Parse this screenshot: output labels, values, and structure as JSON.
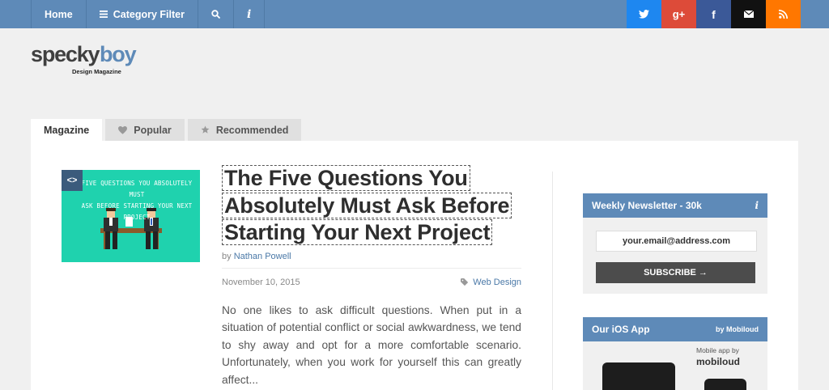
{
  "nav": {
    "home": "Home",
    "category_filter": "Category Filter",
    "search_icon": "search-icon",
    "info_icon": "i"
  },
  "social": [
    {
      "name": "twitter",
      "color": "#1e87f0"
    },
    {
      "name": "google-plus",
      "color": "#dd4b39",
      "label": "g+"
    },
    {
      "name": "facebook",
      "color": "#3b5998",
      "label": "f"
    },
    {
      "name": "email",
      "color": "#111111"
    },
    {
      "name": "rss",
      "color": "#ff7700"
    }
  ],
  "logo": {
    "wordmark": "speckyboy",
    "tagline": "Design Magazine"
  },
  "tabs": {
    "magazine": "Magazine",
    "popular": "Popular",
    "recommended": "Recommended"
  },
  "article": {
    "thumb_badge": "<>",
    "thumb_text_1": "FIVE QUESTIONS YOU ABSOLUTELY MUST",
    "thumb_text_2": "ASK BEFORE STARTING YOUR NEXT PROJECT",
    "title_line1": "The Five Questions You",
    "title_line2": "Absolutely Must Ask Before",
    "title_line3": "Starting Your Next Project",
    "by": "by",
    "author": "Nathan Powell",
    "date": "November 10, 2015",
    "category": "Web Design",
    "excerpt": "No one likes to ask difficult questions. When put in a situation of potential conflict or social awkwardness, we tend to shy away and opt for a more comfortable scenario. Unfortunately, when you work for yourself this can greatly affect..."
  },
  "newsletter": {
    "title": "Weekly Newsletter - 30k",
    "info": "i",
    "email_placeholder": "your.email@address.com",
    "subscribe": "SUBSCRIBE →"
  },
  "ios_app": {
    "title": "Our iOS App",
    "by": "by Mobiloud",
    "mobile_app_by": "Mobile app by",
    "brand": "mobiloud"
  }
}
